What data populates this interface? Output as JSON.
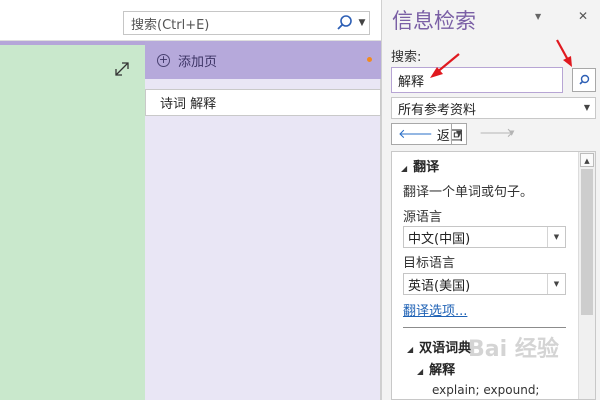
{
  "toolbar": {
    "search_placeholder": "搜索(Ctrl+E)",
    "search_icon": "search-icon",
    "dropdown_icon": "chevron-down-icon"
  },
  "pages": {
    "add_page_label": "添加页",
    "items": [
      {
        "title": "诗词 解释"
      }
    ]
  },
  "research": {
    "title": "信息检索",
    "search_label": "搜索:",
    "search_value": "解释",
    "reference_select": "所有参考资料",
    "back_label": "返回",
    "results": {
      "translate_header": "翻译",
      "translate_desc": "翻译一个单词或句子。",
      "source_label": "源语言",
      "source_value": "中文(中国)",
      "target_label": "目标语言",
      "target_value": "英语(美国)",
      "options_link": "翻译选项...",
      "dict_header": "双语词典",
      "dict_sub": "解释",
      "dict_entry": "explain; expound;"
    }
  },
  "colors": {
    "accent_purple": "#7a5fa5",
    "page_tab": "#b6a9db",
    "canvas_green": "#c9e8cc",
    "annotation_red": "#e0191f"
  }
}
